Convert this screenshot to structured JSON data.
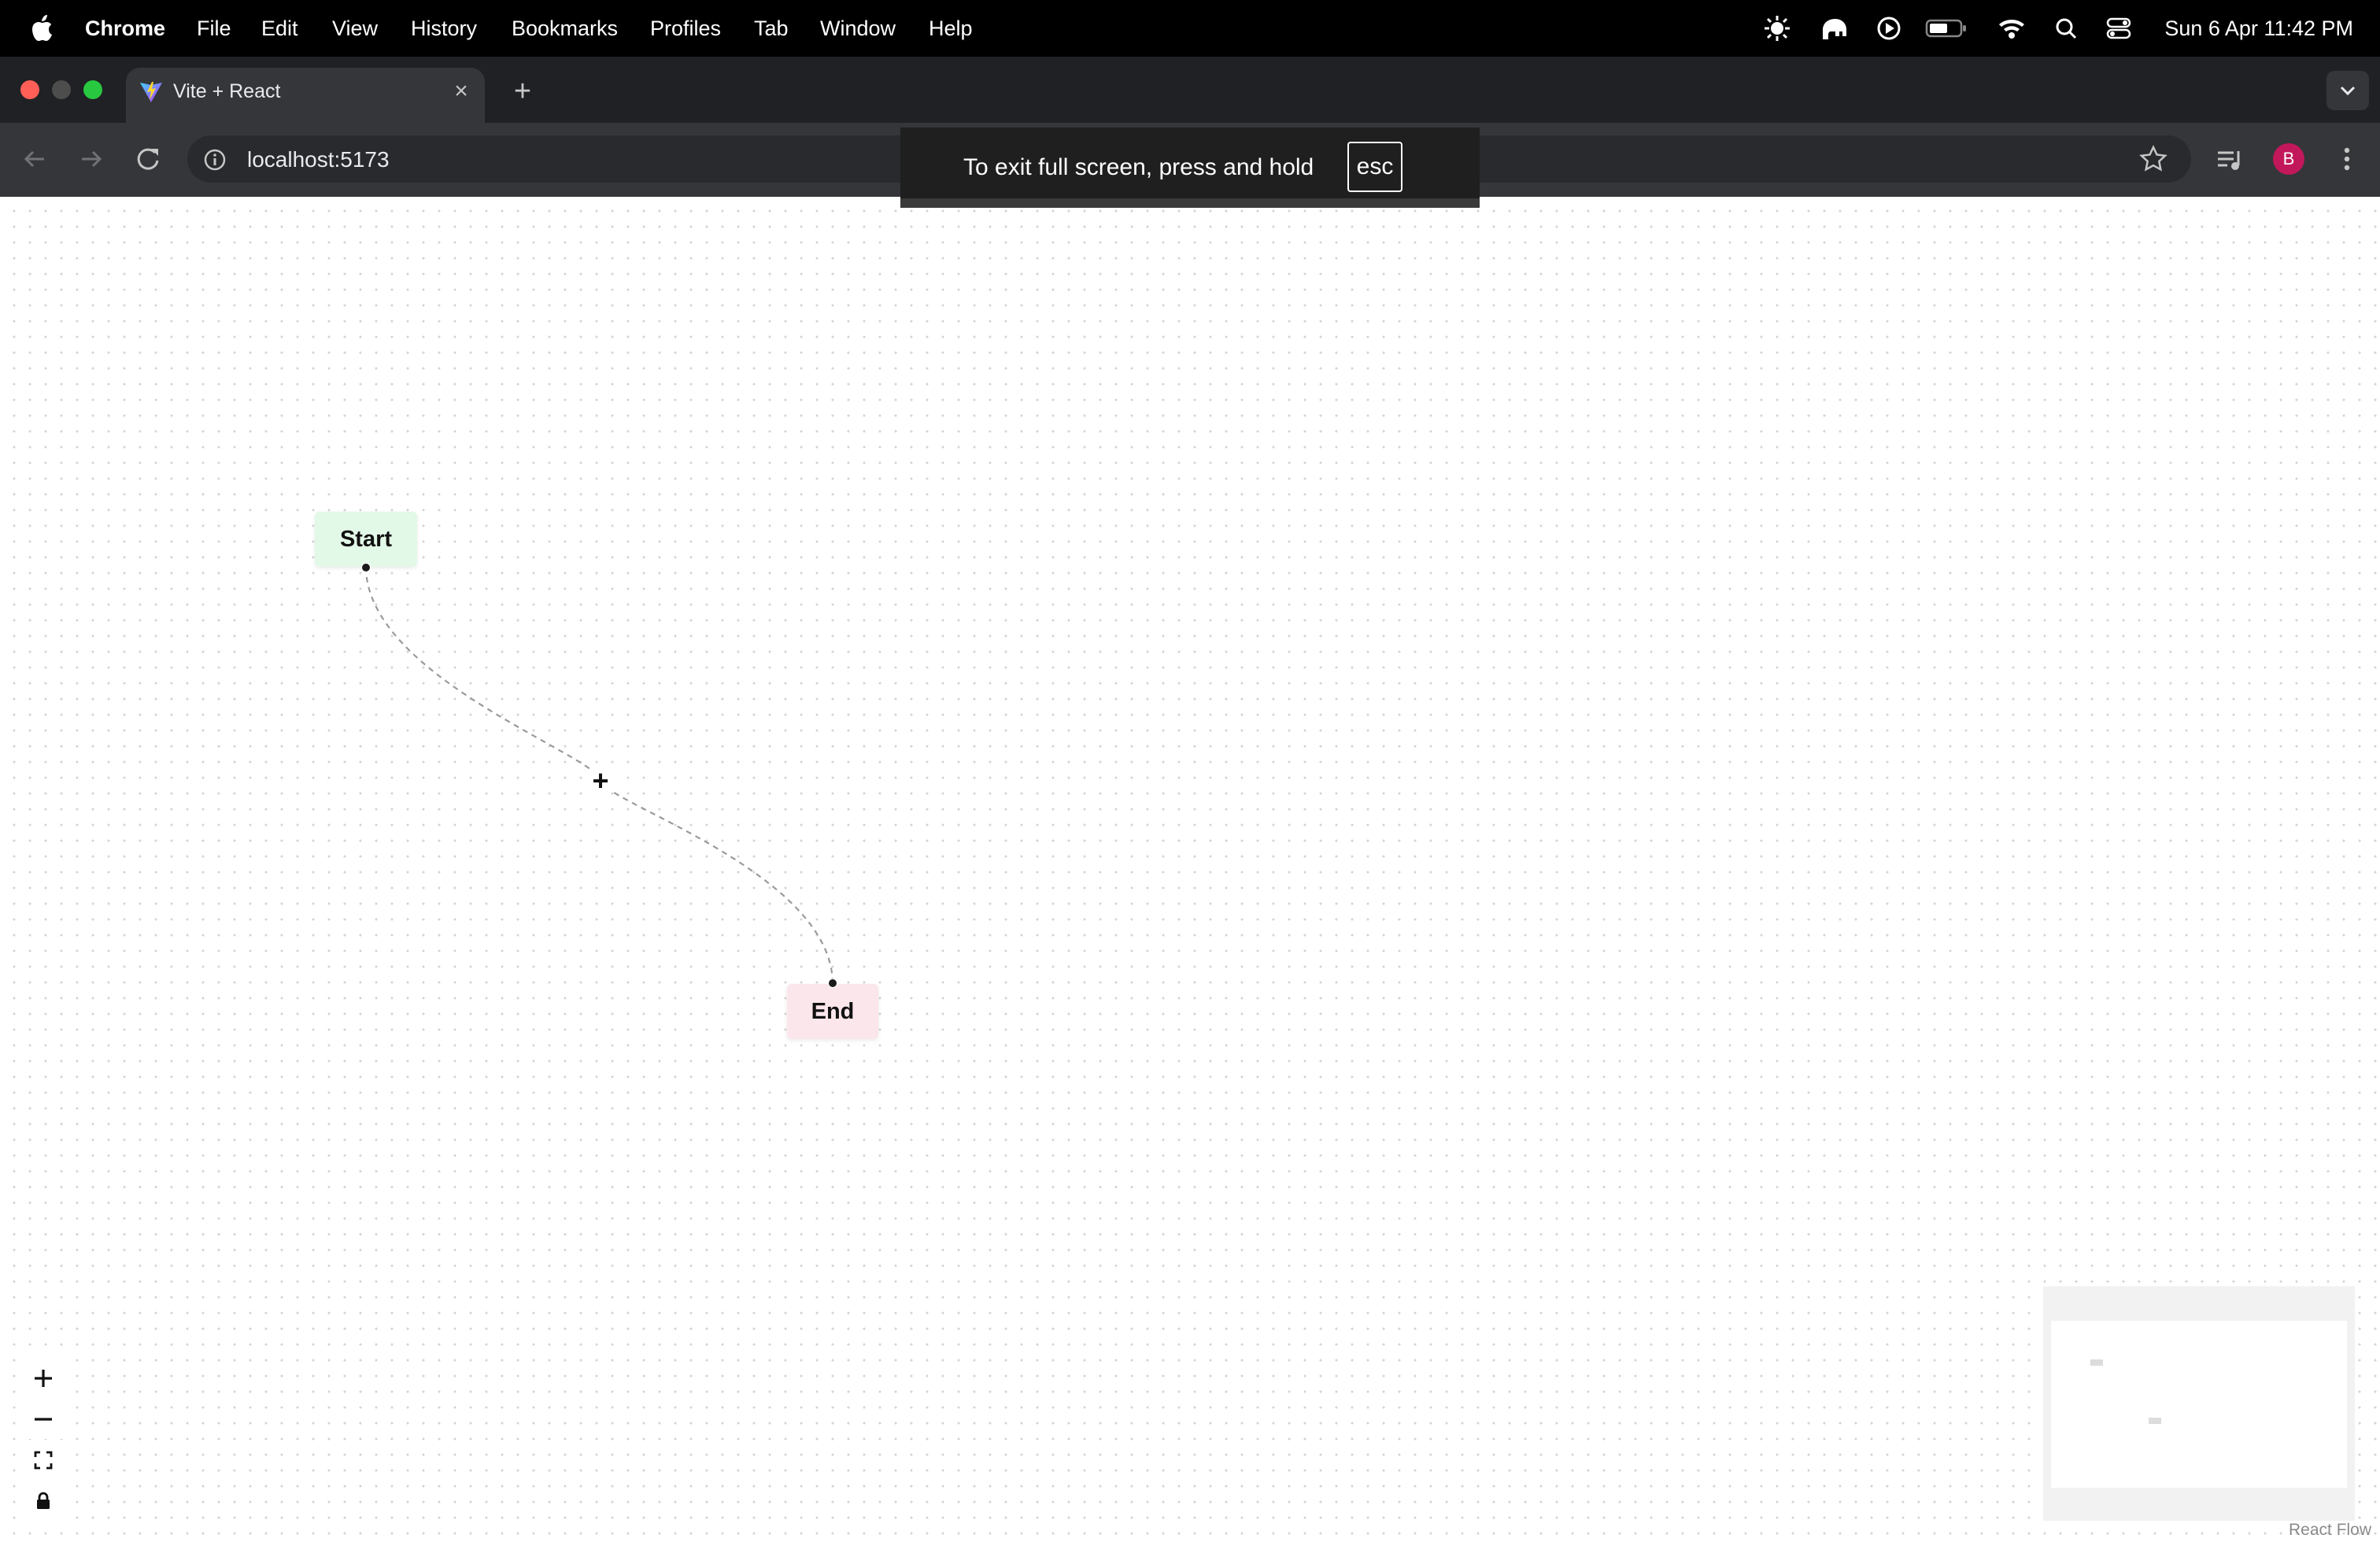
{
  "menubar": {
    "app_name": "Chrome",
    "items": [
      "File",
      "Edit",
      "View",
      "History",
      "Bookmarks",
      "Profiles",
      "Tab",
      "Window",
      "Help"
    ],
    "clock": "Sun 6 Apr  11:42 PM"
  },
  "browser": {
    "tab_title": "Vite + React",
    "url": "localhost:5173",
    "profile_initial": "B",
    "fullscreen_notice": "To exit full screen, press and hold",
    "fullscreen_key": "esc"
  },
  "flow": {
    "nodes": [
      {
        "id": "start",
        "label": "Start",
        "color": "#e3f9e8"
      },
      {
        "id": "end",
        "label": "End",
        "color": "#fbe6ec"
      }
    ],
    "edge_add_label": "+",
    "attribution": "React Flow"
  },
  "colors": {
    "traffic_close": "#ff5f57",
    "traffic_minimize": "#4d4d4d",
    "traffic_zoom": "#28c840",
    "avatar": "#c2185b"
  }
}
